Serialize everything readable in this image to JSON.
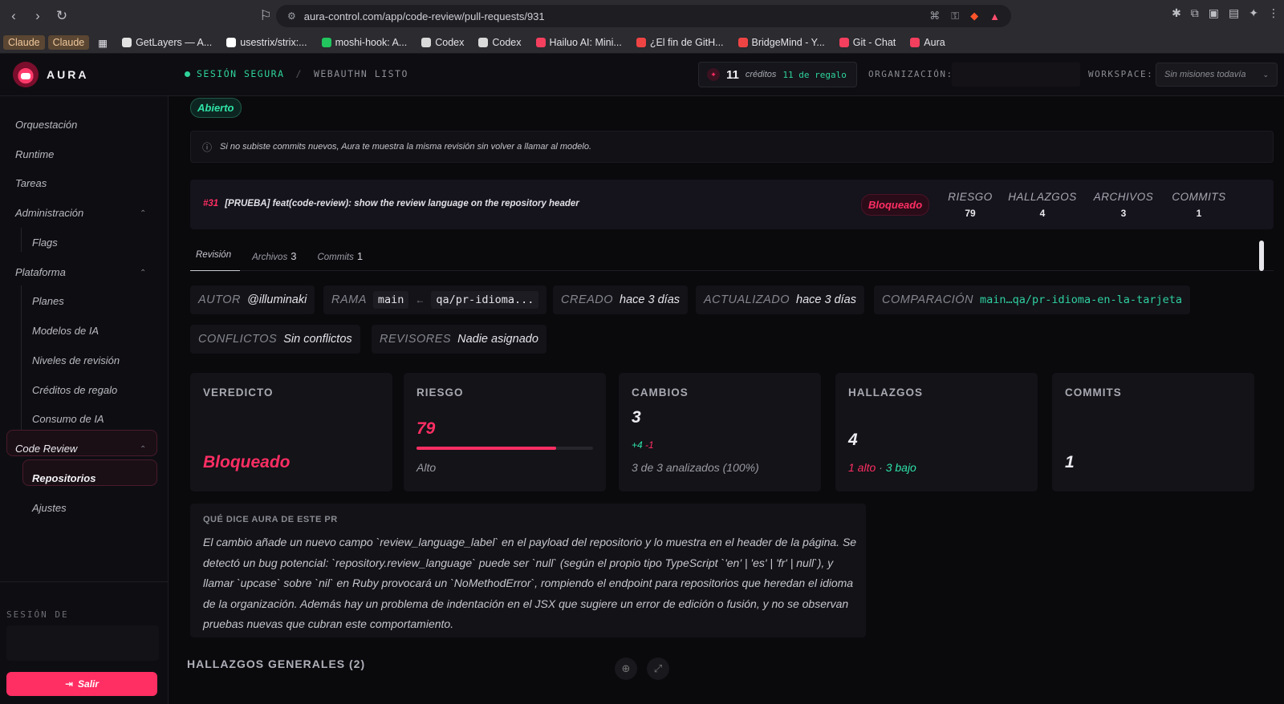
{
  "browser": {
    "url": "aura-control.com/app/code-review/pull-requests/931",
    "bookmarks": [
      {
        "label": "Claude",
        "tag": true
      },
      {
        "label": "Claude",
        "tag": true
      },
      {
        "label": "GetLayers — A...",
        "color": "#e2e2e2"
      },
      {
        "label": "usestrix/strix:...",
        "color": "#ffffff"
      },
      {
        "label": "moshi-hook: A...",
        "color": "#22c55e"
      },
      {
        "label": "Codex",
        "color": "#d9d9d9"
      },
      {
        "label": "Codex",
        "color": "#d9d9d9"
      },
      {
        "label": "Hailuo AI: Mini...",
        "color": "#f43f5e"
      },
      {
        "label": "¿El fin de GitH...",
        "color": "#ef4444"
      },
      {
        "label": "BridgeMind - Y...",
        "color": "#ef4444"
      },
      {
        "label": "Git - Chat",
        "color": "#f43f5e"
      },
      {
        "label": "Aura",
        "color": "#f43f5e"
      }
    ]
  },
  "header": {
    "brand": "AURA",
    "secure": "SESIÓN SEGURA",
    "separator": "/",
    "webauthn": "WEBAUTHN LISTO",
    "credits_num": "11",
    "credits_text": "créditos",
    "credits_gift": "11 de regalo",
    "org_label": "ORGANIZACIÓN:",
    "ws_label": "WORKSPACE:",
    "ws_value": "Sin misiones todavía"
  },
  "sidebar": {
    "items": [
      "Orquestación",
      "Runtime",
      "Tareas",
      "Administración",
      "Flags",
      "Plataforma",
      "Planes",
      "Modelos de IA",
      "Niveles de revisión",
      "Créditos de regalo",
      "Consumo de IA",
      "Code Review",
      "Repositorios",
      "Ajustes"
    ],
    "session_label": "SESIÓN DE",
    "logout": "Salir"
  },
  "pr": {
    "state": "Abierto",
    "info": "Si no subiste commits nuevos, Aura te muestra la misma revisión sin volver a llamar al modelo.",
    "number": "#31",
    "title": "[PRUEBA] feat(code-review): show the review language on the repository header",
    "verdict_pill": "Bloqueado",
    "stats": [
      {
        "k": "RIESGO",
        "v": "79"
      },
      {
        "k": "HALLAZGOS",
        "v": "4"
      },
      {
        "k": "ARCHIVOS",
        "v": "3"
      },
      {
        "k": "COMMITS",
        "v": "1"
      }
    ]
  },
  "tabs": [
    {
      "label": "Revisión",
      "count": ""
    },
    {
      "label": "Archivos",
      "count": "3"
    },
    {
      "label": "Commits",
      "count": "1"
    }
  ],
  "meta": {
    "author_k": "AUTOR",
    "author_v": "@illuminaki",
    "branch_k": "RAMA",
    "branch_base": "main",
    "branch_arrow": "←",
    "branch_head": "qa/pr-idioma...",
    "created_k": "CREADO",
    "created_v": "hace 3 días",
    "updated_k": "ACTUALIZADO",
    "updated_v": "hace 3 días",
    "compare_k": "COMPARACIÓN",
    "compare_v": "main…qa/pr-idioma-en-la-tarjeta",
    "conflicts_k": "CONFLICTOS",
    "conflicts_v": "Sin conflictos",
    "reviewers_k": "REVISORES",
    "reviewers_v": "Nadie asignado"
  },
  "cards": {
    "verdict_k": "VEREDICTO",
    "verdict_v": "Bloqueado",
    "risk_k": "RIESGO",
    "risk_v": "79",
    "risk_level": "Alto",
    "risk_fraction": 0.79,
    "changes_k": "CAMBIOS",
    "changes_v": "3",
    "changes_plus": "+4",
    "changes_minus": "-1",
    "changes_note": "3 de 3 analizados (100%)",
    "findings_k": "HALLAZGOS",
    "findings_v": "4",
    "findings_high": "1 alto",
    "findings_sep": "·",
    "findings_low": "3 bajo",
    "commits_k": "COMMITS",
    "commits_v": "1"
  },
  "summary": {
    "title": "QUÉ DICE AURA DE ESTE PR",
    "body": "El cambio añade un nuevo campo `review_language_label` en el payload del repositorio y lo muestra en el header de la página. Se detectó un bug potencial: `repository.review_language` puede ser `null` (según el propio tipo TypeScript `'en' | 'es' | 'fr' | null`), y llamar `upcase` sobre `nil` en Ruby provocará un `NoMethodError`, rompiendo el endpoint para repositorios que heredan el idioma de la organización. Además hay un problema de indentación en el JSX que sugiere un error de edición o fusión, y no se observan pruebas nuevas que cubran este comportamiento."
  },
  "findings_title": "HALLAZGOS GENERALES (2)",
  "colors": {
    "accent": "#ff2e63",
    "success": "#2fe3a7",
    "bg": "#0a0a0d"
  }
}
